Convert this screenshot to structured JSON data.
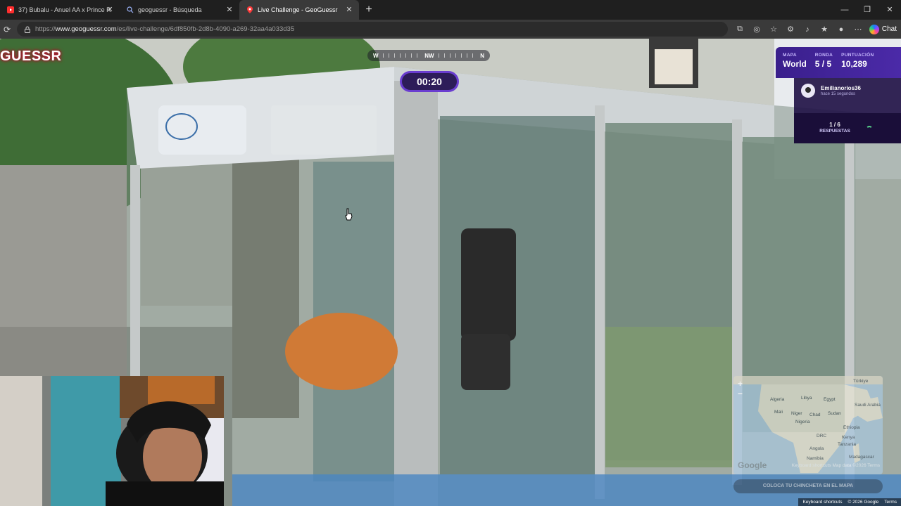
{
  "browser": {
    "tabs": [
      {
        "title": "37) Bubalu - Anuel AA x Prince R",
        "active": false,
        "favicon": "youtube-icon"
      },
      {
        "title": "geoguessr - Búsqueda",
        "active": false,
        "favicon": "search-icon"
      },
      {
        "title": "Live Challenge - GeoGuessr",
        "active": true,
        "favicon": "geoguessr-pin-icon"
      }
    ],
    "new_tab_glyph": "+",
    "url": {
      "prefix": "https://",
      "domain": "www.geoguessr.com",
      "path": "/es/live-challenge/6df850fb-2d8b-4090-a269-32aa4a033d35"
    },
    "chat_label": "Chat"
  },
  "game": {
    "brand": "GUESSR",
    "compass": {
      "left": "W",
      "center": "NW",
      "right": "N"
    },
    "timer": "00:20",
    "hud": {
      "map_label": "MAPA",
      "map_value": "World",
      "round_label": "RONDA",
      "round_value": "5 / 5",
      "score_label": "PUNTUACIÓN",
      "score_value": "10,289"
    },
    "player": {
      "name": "Emilianorios36",
      "subtitle": "hace 15 segundos"
    },
    "answers": {
      "count": "1 / 6",
      "label": "RESPUESTAS"
    },
    "minimap": {
      "zoom_in": "+",
      "zoom_out": "−",
      "labels": [
        "Türkiye",
        "Algeria",
        "Libya",
        "Egypt",
        "Saudi Arabia",
        "Mali",
        "Niger",
        "Chad",
        "Sudan",
        "Nigeria",
        "Ethiopia",
        "DRC",
        "Kenya",
        "Tanzania",
        "Angola",
        "Madagascar",
        "Namibia"
      ],
      "google_logo": "Google",
      "credits": "Keyboard shortcuts  Map data ©2026  Terms"
    },
    "guess_button": "COLOCA TU CHINCHETA EN EL MAPA",
    "bottom_credits": {
      "shortcuts": "Keyboard shortcuts",
      "copyright": "© 2026 Google",
      "terms": "Terms"
    }
  },
  "colors": {
    "accent_purple": "#4b2aa8",
    "timer_ring": "#6a3dd0",
    "brand_red": "#c0002a"
  }
}
